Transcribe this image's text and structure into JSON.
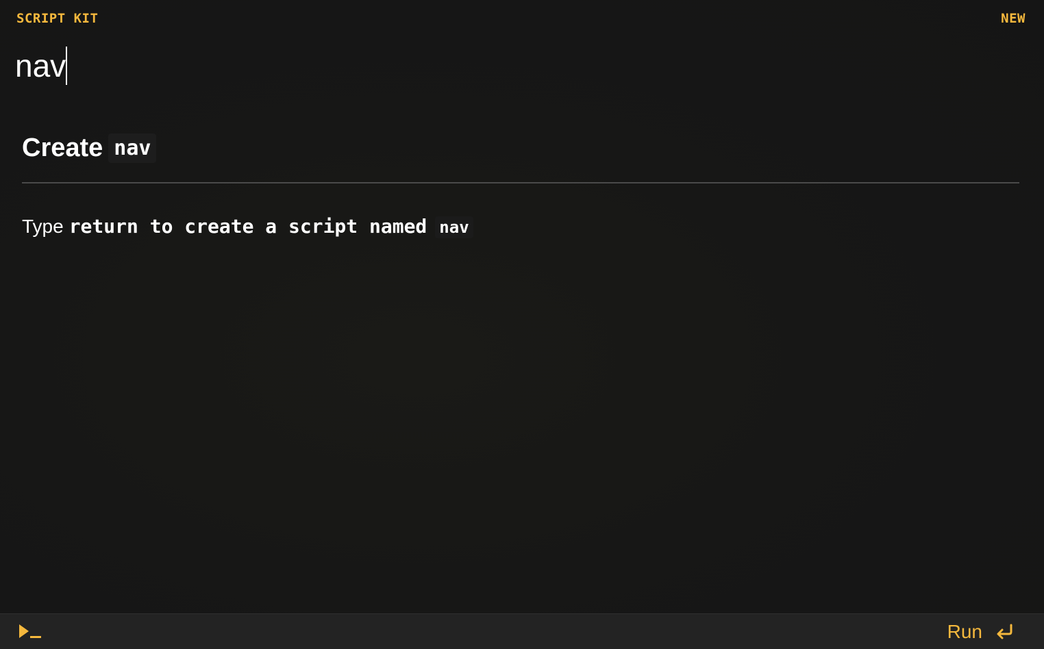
{
  "header": {
    "brand": "SCRIPT KIT",
    "mode": "NEW"
  },
  "prompt": {
    "value": "nav"
  },
  "preview": {
    "heading_word": "Create",
    "heading_code": "nav",
    "instruction_lead": "Type",
    "instruction_mono": "return to create a script named",
    "instruction_code": "nav"
  },
  "footer": {
    "left_icon": "terminal-icon",
    "run_label": "Run",
    "run_icon": "enter-key-icon"
  },
  "colors": {
    "accent": "#f5b83d",
    "background": "#161616",
    "footer_background": "#232323",
    "divider": "#4a4a4a",
    "text": "#ffffff"
  }
}
